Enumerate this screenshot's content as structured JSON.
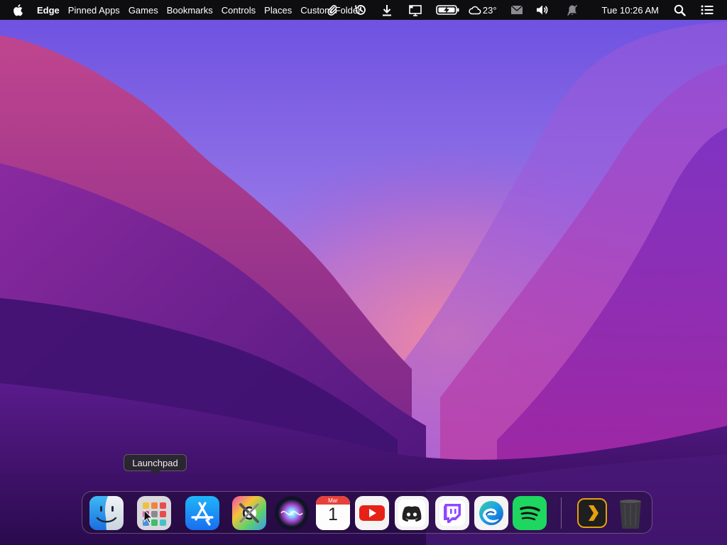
{
  "menubar": {
    "app_name": "Edge",
    "items": [
      "Pinned Apps",
      "Games",
      "Bookmarks",
      "Controls",
      "Places",
      "Custom Folder"
    ],
    "status_icons": [
      "paperclip-icon",
      "history-icon",
      "download-icon",
      "display-icon",
      "battery-charging-icon",
      "cloud-icon",
      "mail-icon",
      "volume-icon",
      "notifications-off-icon",
      "search-icon",
      "control-center-icon"
    ],
    "weather_temp": "23°",
    "clock": "Tue 10:26 AM"
  },
  "tooltip": {
    "label": "Launchpad"
  },
  "dock": {
    "apps": [
      {
        "name": "Finder",
        "icon": "finder-icon"
      },
      {
        "name": "Launchpad",
        "icon": "launchpad-icon"
      },
      {
        "name": "App Store",
        "icon": "app-store-icon"
      },
      {
        "name": "Utilities",
        "icon": "utilities-icon"
      },
      {
        "name": "Siri",
        "icon": "siri-icon"
      },
      {
        "name": "Calendar",
        "icon": "calendar-icon"
      },
      {
        "name": "YouTube",
        "icon": "youtube-icon"
      },
      {
        "name": "Discord",
        "icon": "discord-icon"
      },
      {
        "name": "Twitch",
        "icon": "twitch-icon"
      },
      {
        "name": "Edge",
        "icon": "edge-icon"
      },
      {
        "name": "Spotify",
        "icon": "spotify-icon"
      },
      {
        "name": "Plex",
        "icon": "plex-icon"
      },
      {
        "name": "Trash",
        "icon": "trash-icon"
      }
    ],
    "calendar": {
      "month": "Mar",
      "day": "1"
    }
  },
  "colors": {
    "menubar_bg": "#0e0e10",
    "wallpaper_top": "#7a5ad9",
    "wallpaper_glow": "#e8709a",
    "wallpaper_dark": "#2a0d4a"
  }
}
